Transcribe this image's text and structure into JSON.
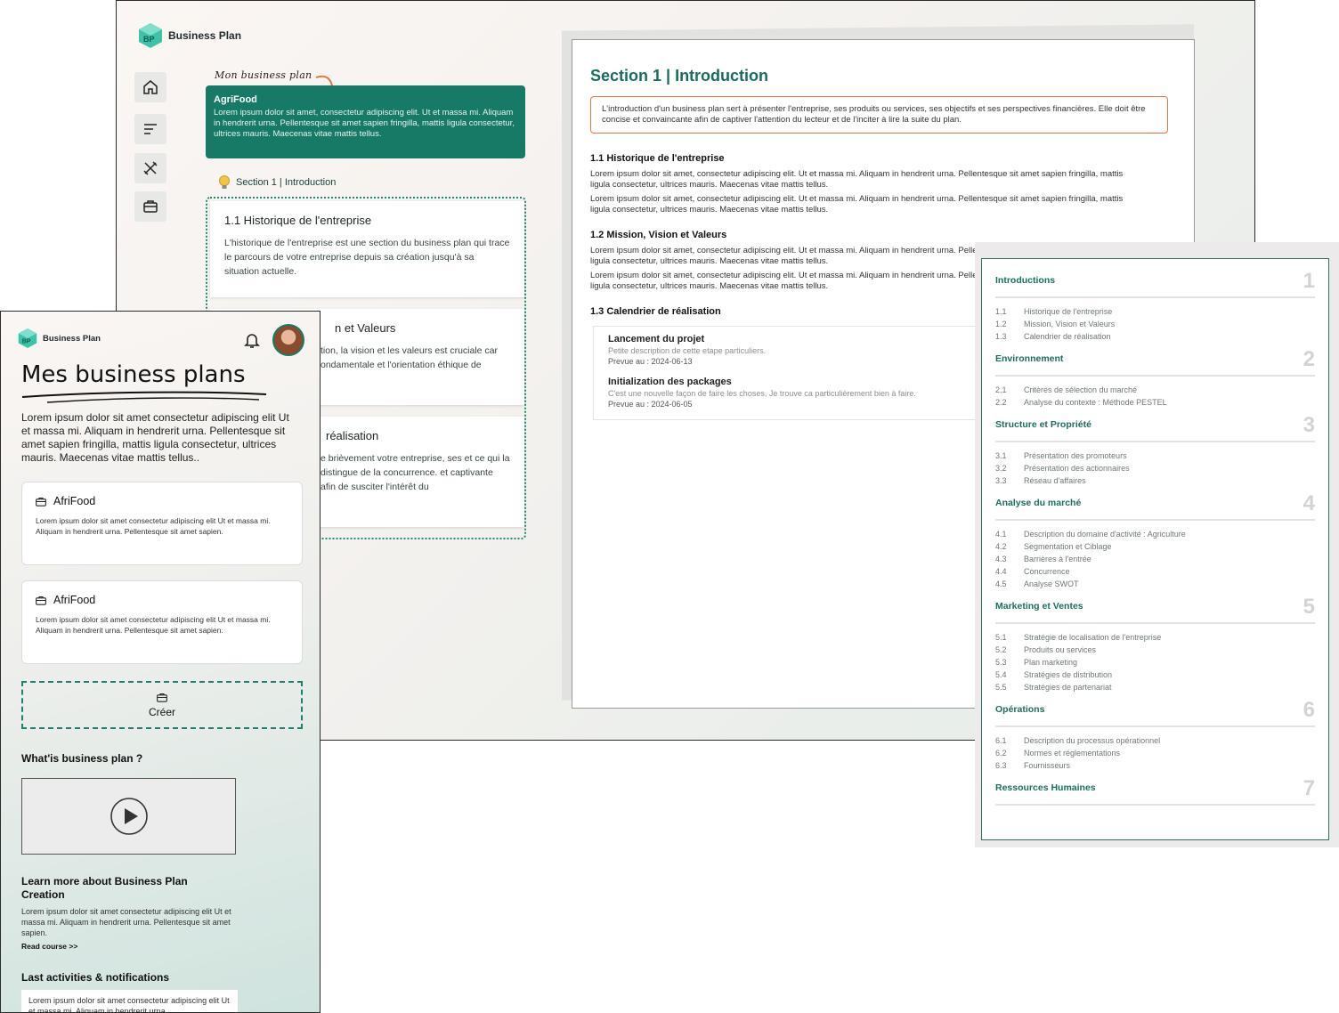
{
  "desktop": {
    "brand": "Business Plan",
    "nav_icons": [
      "home-icon",
      "menu-lines-icon",
      "tools-icon",
      "briefcase-icon"
    ],
    "hand_label": "Mon business plan",
    "plan": {
      "title": "AgriFood",
      "text": "Lorem ipsum dolor sit amet, consectetur adipiscing elit. Ut et massa mi. Aliquam in hendrerit urna. Pellentesque sit amet sapien fringilla, mattis ligula consectetur, ultrices mauris. Maecenas vitae mattis tellus."
    },
    "section_label": "Section 1 | Introduction",
    "subsections": [
      {
        "title": "1.1  Historique de l'entreprise",
        "text": "L'historique de l'entreprise est une section du business plan qui trace le parcours de votre entreprise depuis sa création jusqu'à sa situation actuelle."
      },
      {
        "title": "n et Valeurs",
        "text": "tion, la vision et les valeurs est cruciale car ondamentale et l'orientation éthique de"
      },
      {
        "title": "réalisation",
        "text": "e brièvement votre entreprise, ses et ce qui la distingue de la concurrence. et captivante afin de susciter l'intérêt du"
      }
    ],
    "doc": {
      "title": "Section 1 | Introduction",
      "intro": "L'introduction d'un business plan sert à présenter l'entreprise, ses produits ou services, ses objectifs et ses perspectives financières. Elle doit être concise et convaincante afin de captiver l'attention du lecteur et de l'inciter à lire la suite du plan.",
      "h1": "1.1 Historique de l'entreprise",
      "p1a": "Lorem ipsum dolor sit amet, consectetur adipiscing elit. Ut et massa mi. Aliquam in hendrerit urna. Pellentesque sit amet sapien fringilla, mattis ligula consectetur, ultrices mauris. Maecenas vitae mattis tellus.",
      "p1b": "Lorem ipsum dolor sit amet, consectetur adipiscing elit. Ut et massa mi. Aliquam in hendrerit urna. Pellentesque sit amet sapien fringilla, mattis ligula consectetur, ultrices mauris. Maecenas vitae mattis tellus.",
      "h2": "1.2 Mission, Vision et Valeurs",
      "p2a": "Lorem ipsum dolor sit amet, consectetur adipiscing elit. Ut et massa mi. Aliquam in hendrerit urna. Pellentesque sit amet sapien fringilla, mattis ligula consectetur, ultrices mauris. Maecenas vitae mattis tellus.",
      "p2b": "Lorem ipsum dolor sit amet, consectetur adipiscing elit. Ut et massa mi. Aliquam in hendrerit urna. Pellentesque sit amet sapien fringilla, mattis ligula consectetur, ultrices mauris. Maecenas vitae mattis tellus.",
      "h3": "1.3 Calendrier de réalisation",
      "tasks": [
        {
          "title": "Lancement du projet",
          "desc": "Petite description de cette etape particuliers.",
          "date": "Prevue au : 2024-06-13"
        },
        {
          "title": "Initialization des packages",
          "desc": "C'est une nouvelle façon de faire les choses, Je trouve ca particulièrement bien à faire.",
          "date": "Prevue au : 2024-06-05"
        }
      ]
    }
  },
  "toc": {
    "sections": [
      {
        "title": "Introductions",
        "num": "1",
        "items": [
          [
            "1.1",
            "Historique de l'entreprise"
          ],
          [
            "1.2",
            "Mission, Vision et Valeurs"
          ],
          [
            "1.3",
            "Calendrier de réalisation"
          ]
        ]
      },
      {
        "title": "Environnement",
        "num": "2",
        "items": [
          [
            "2.1",
            "Critères de sélection du marché"
          ],
          [
            "2.2",
            "Analyse du contexte : Méthode PESTEL"
          ]
        ]
      },
      {
        "title": "Structure et Propriété",
        "num": "3",
        "items": [
          [
            "3.1",
            "Présentation des promoteurs"
          ],
          [
            "3.2",
            "Présentation des actionnaires"
          ],
          [
            "3.3",
            "Réseau d'affaires"
          ]
        ]
      },
      {
        "title": "Analyse du marché",
        "num": "4",
        "items": [
          [
            "4.1",
            "Description du domaine d'activité : Agriculture"
          ],
          [
            "4.2",
            "Segmentation et Ciblage"
          ],
          [
            "4.3",
            "Barrières à l'entrée"
          ],
          [
            "4.4",
            "Concurrence"
          ],
          [
            "4.5",
            "Analyse SWOT"
          ]
        ]
      },
      {
        "title": "Marketing et Ventes",
        "num": "5",
        "items": [
          [
            "5.1",
            "Stratégie de localisation de l'entreprise"
          ],
          [
            "5.2",
            "Produits ou services"
          ],
          [
            "5.3",
            "Plan marketing"
          ],
          [
            "5.4",
            "Stratégies de distribution"
          ],
          [
            "5.5",
            "Stratégies de partenariat"
          ]
        ]
      },
      {
        "title": "Opérations",
        "num": "6",
        "items": [
          [
            "6.1",
            "Description du processus opérationnel"
          ],
          [
            "6.2",
            "Normes et réglementations"
          ],
          [
            "6.3",
            "Fournisseurs"
          ]
        ]
      },
      {
        "title": "Ressources Humaines",
        "num": "7",
        "items": []
      }
    ]
  },
  "mobile": {
    "brand": "Business Plan",
    "title": "Mes business plans",
    "desc": "Lorem ipsum dolor sit amet consectetur adipiscing elit Ut et massa mi. Aliquam in hendrerit urna. Pellentesque sit amet sapien fringilla, mattis ligula consectetur, ultrices mauris. Maecenas vitae mattis tellus..",
    "cards": [
      {
        "title": "AfriFood",
        "text": "Lorem ipsum dolor sit amet consectetur adipiscing elit Ut et massa mi. Aliquam in hendrerit urna. Pellentesque sit amet sapien."
      },
      {
        "title": "AfriFood",
        "text": "Lorem ipsum dolor sit amet consectetur adipiscing elit Ut et massa mi. Aliquam in hendrerit urna. Pellentesque sit amet sapien."
      }
    ],
    "create_label": "Créer",
    "whatis": "What'is business plan ?",
    "learn_title": "Learn more about Business Plan Creation",
    "learn_text": "Lorem ipsum dolor sit amet consectetur adipiscing elit Ut et massa mi. Aliquam in hendrerit urna. Pellentesque sit amet sapien.",
    "read_link": "Read course >>",
    "activities_title": "Last activities & notifications",
    "notif_text": "Lorem ipsum dolor sit amet consectetur adipiscing elit Ut et massa mi. Aliquam in hendrerit urna."
  },
  "colors": {
    "brand_green": "#177a66",
    "accent_orange": "#e4793b"
  }
}
